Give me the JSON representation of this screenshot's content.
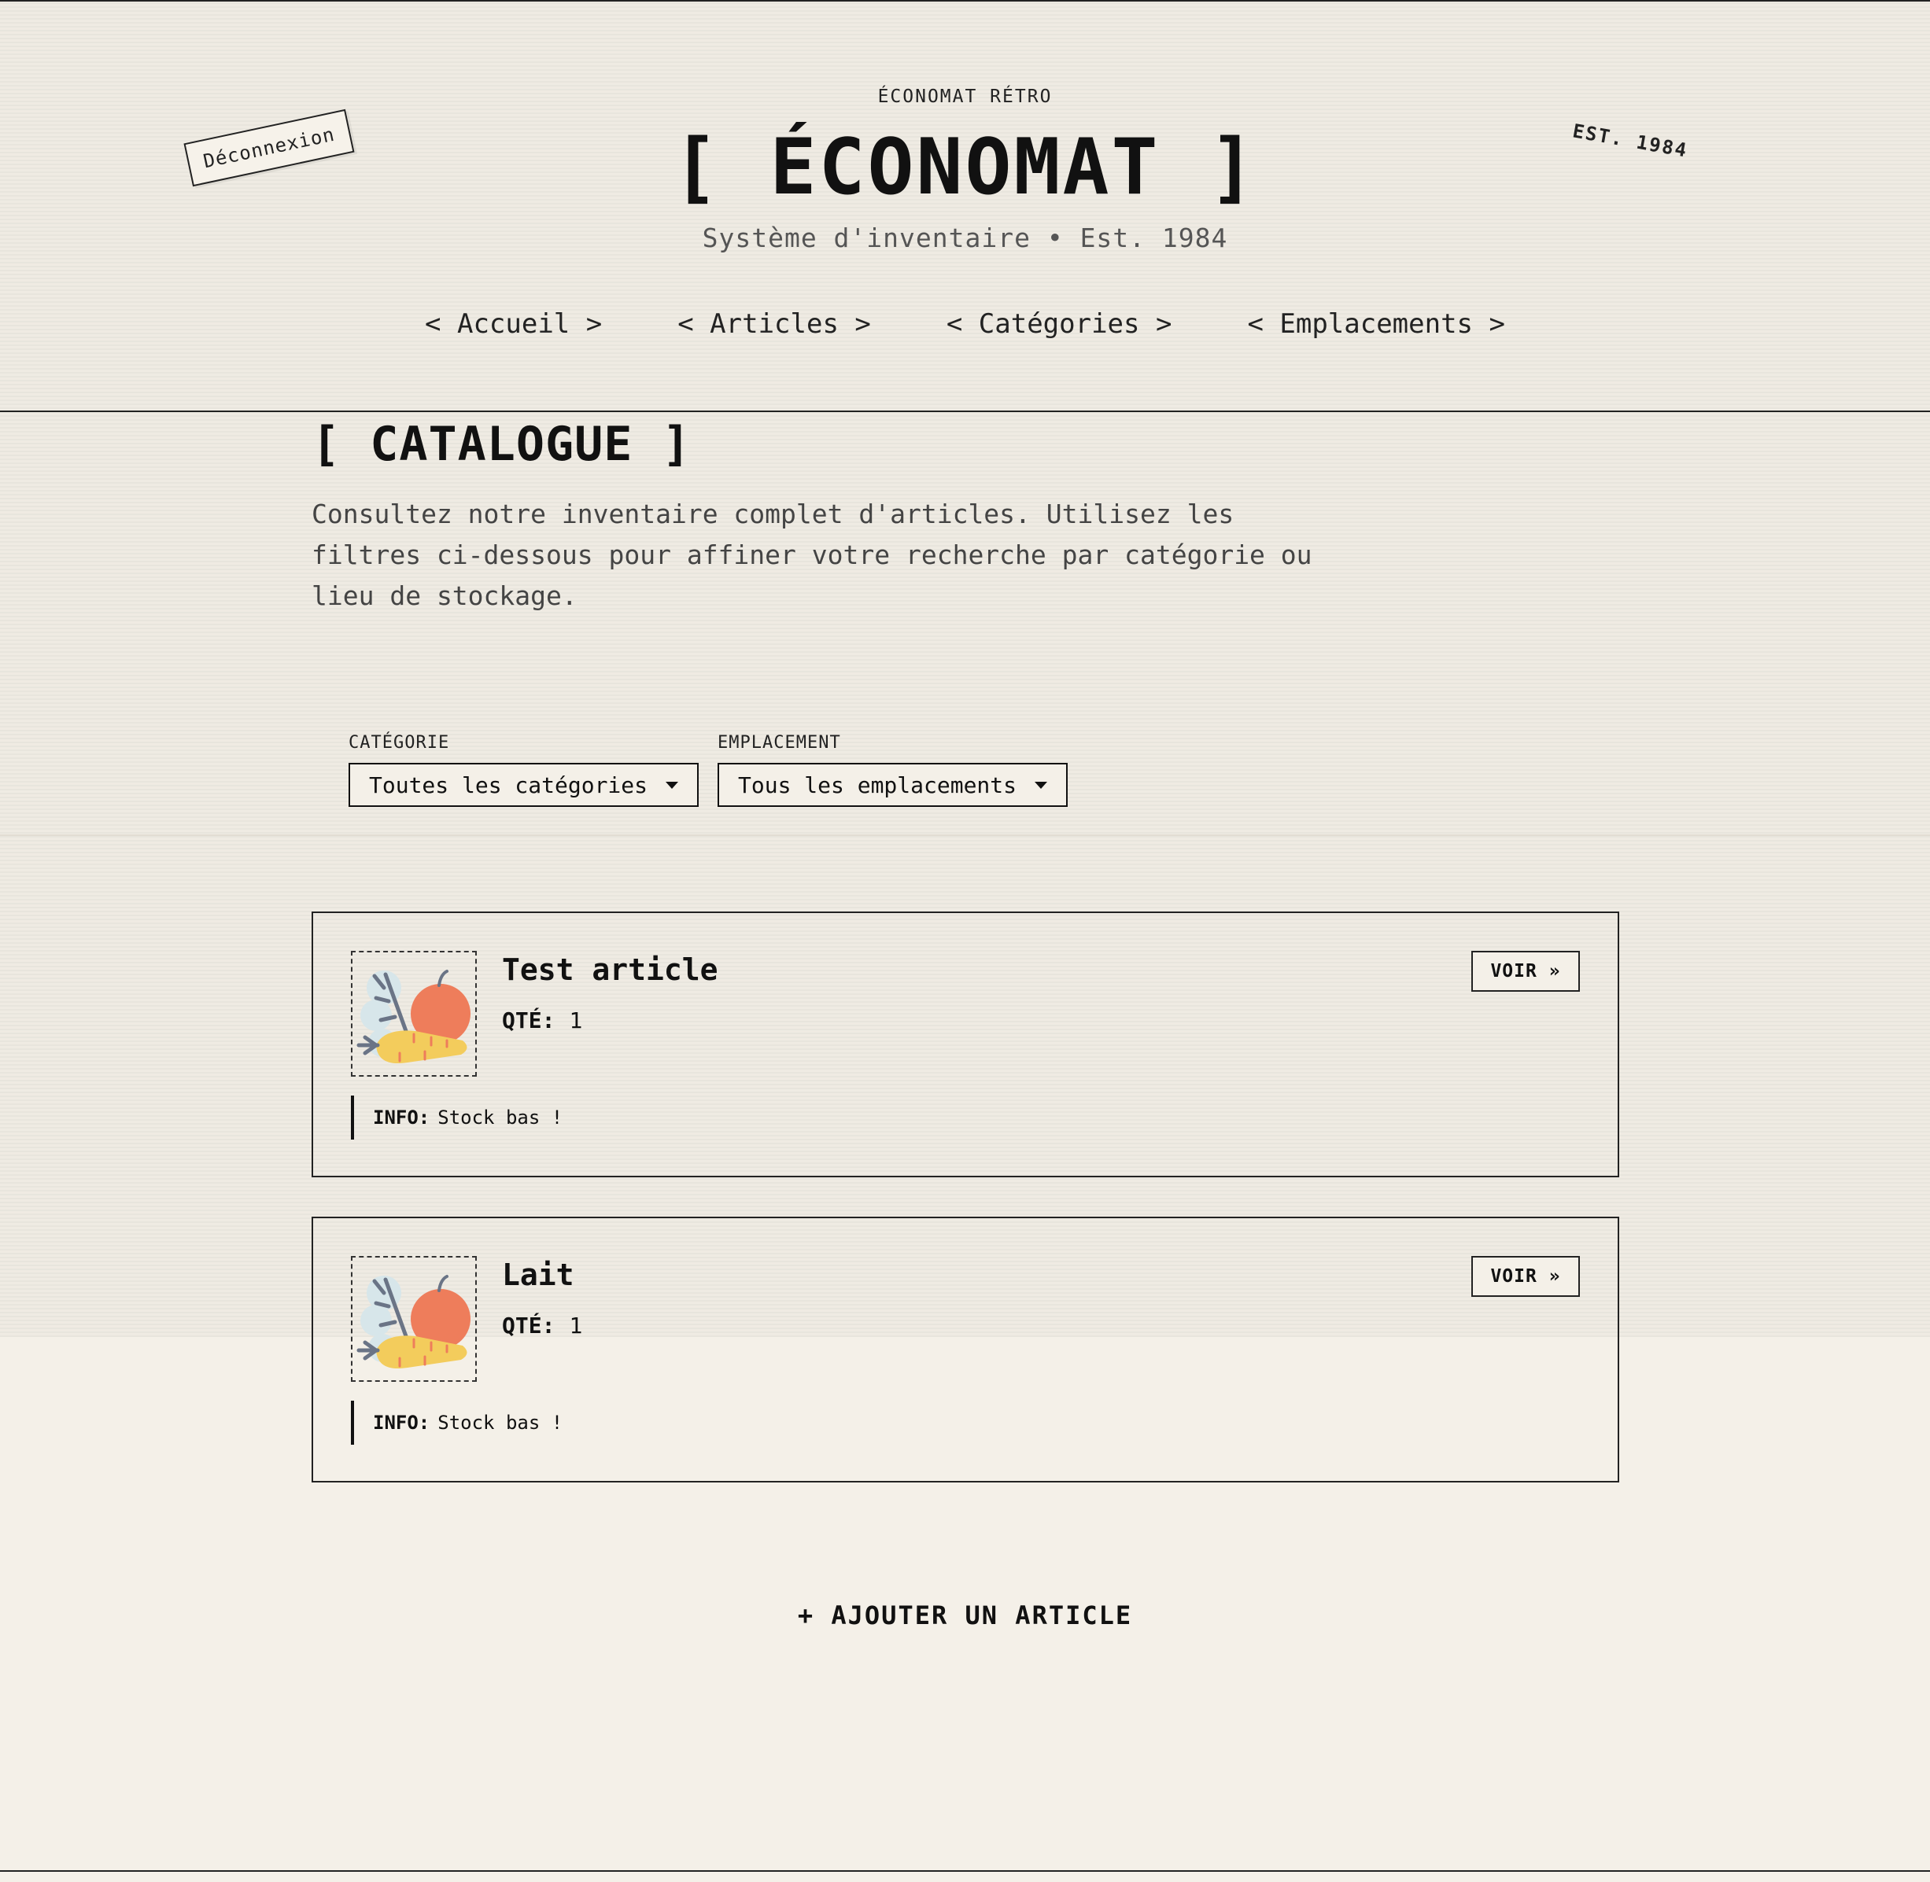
{
  "header": {
    "kicker": "ÉCONOMAT RÉTRO",
    "title": "[ ÉCONOMAT ]",
    "tagline": "Système d'inventaire • Est. 1984",
    "logout_label": "Déconnexion",
    "stamp": "EST. 1984"
  },
  "nav": {
    "items": [
      {
        "label": "< Accueil >"
      },
      {
        "label": "< Articles >"
      },
      {
        "label": "< Catégories >"
      },
      {
        "label": "< Emplacements >"
      }
    ]
  },
  "main": {
    "heading": "[ CATALOGUE ]",
    "intro": "Consultez notre inventaire complet d'articles. Utilisez les filtres ci-dessous pour affiner votre recherche par catégorie ou lieu de stockage."
  },
  "filters": {
    "category": {
      "label": "CATÉGORIE",
      "value": "Toutes les catégories"
    },
    "location": {
      "label": "EMPLACEMENT",
      "value": "Tous les emplacements"
    }
  },
  "items": [
    {
      "title": "Test article",
      "qty_label": "QTÉ:",
      "qty": "1",
      "view_label": "VOIR »",
      "info_label": "INFO:",
      "info": "Stock bas !",
      "icon": "produce-icon"
    },
    {
      "title": "Lait",
      "qty_label": "QTÉ:",
      "qty": "1",
      "view_label": "VOIR »",
      "info_label": "INFO:",
      "info": "Stock bas !",
      "icon": "produce-icon"
    }
  ],
  "actions": {
    "add_label": "+ AJOUTER UN ARTICLE"
  },
  "colors": {
    "background": "#f4f0e8",
    "ink": "#111111",
    "muted": "#555555",
    "produce_orange": "#ee7d5b",
    "produce_yellow": "#f3cc5c",
    "produce_leaf": "#d7e6ea",
    "produce_stem": "#6a7486"
  }
}
